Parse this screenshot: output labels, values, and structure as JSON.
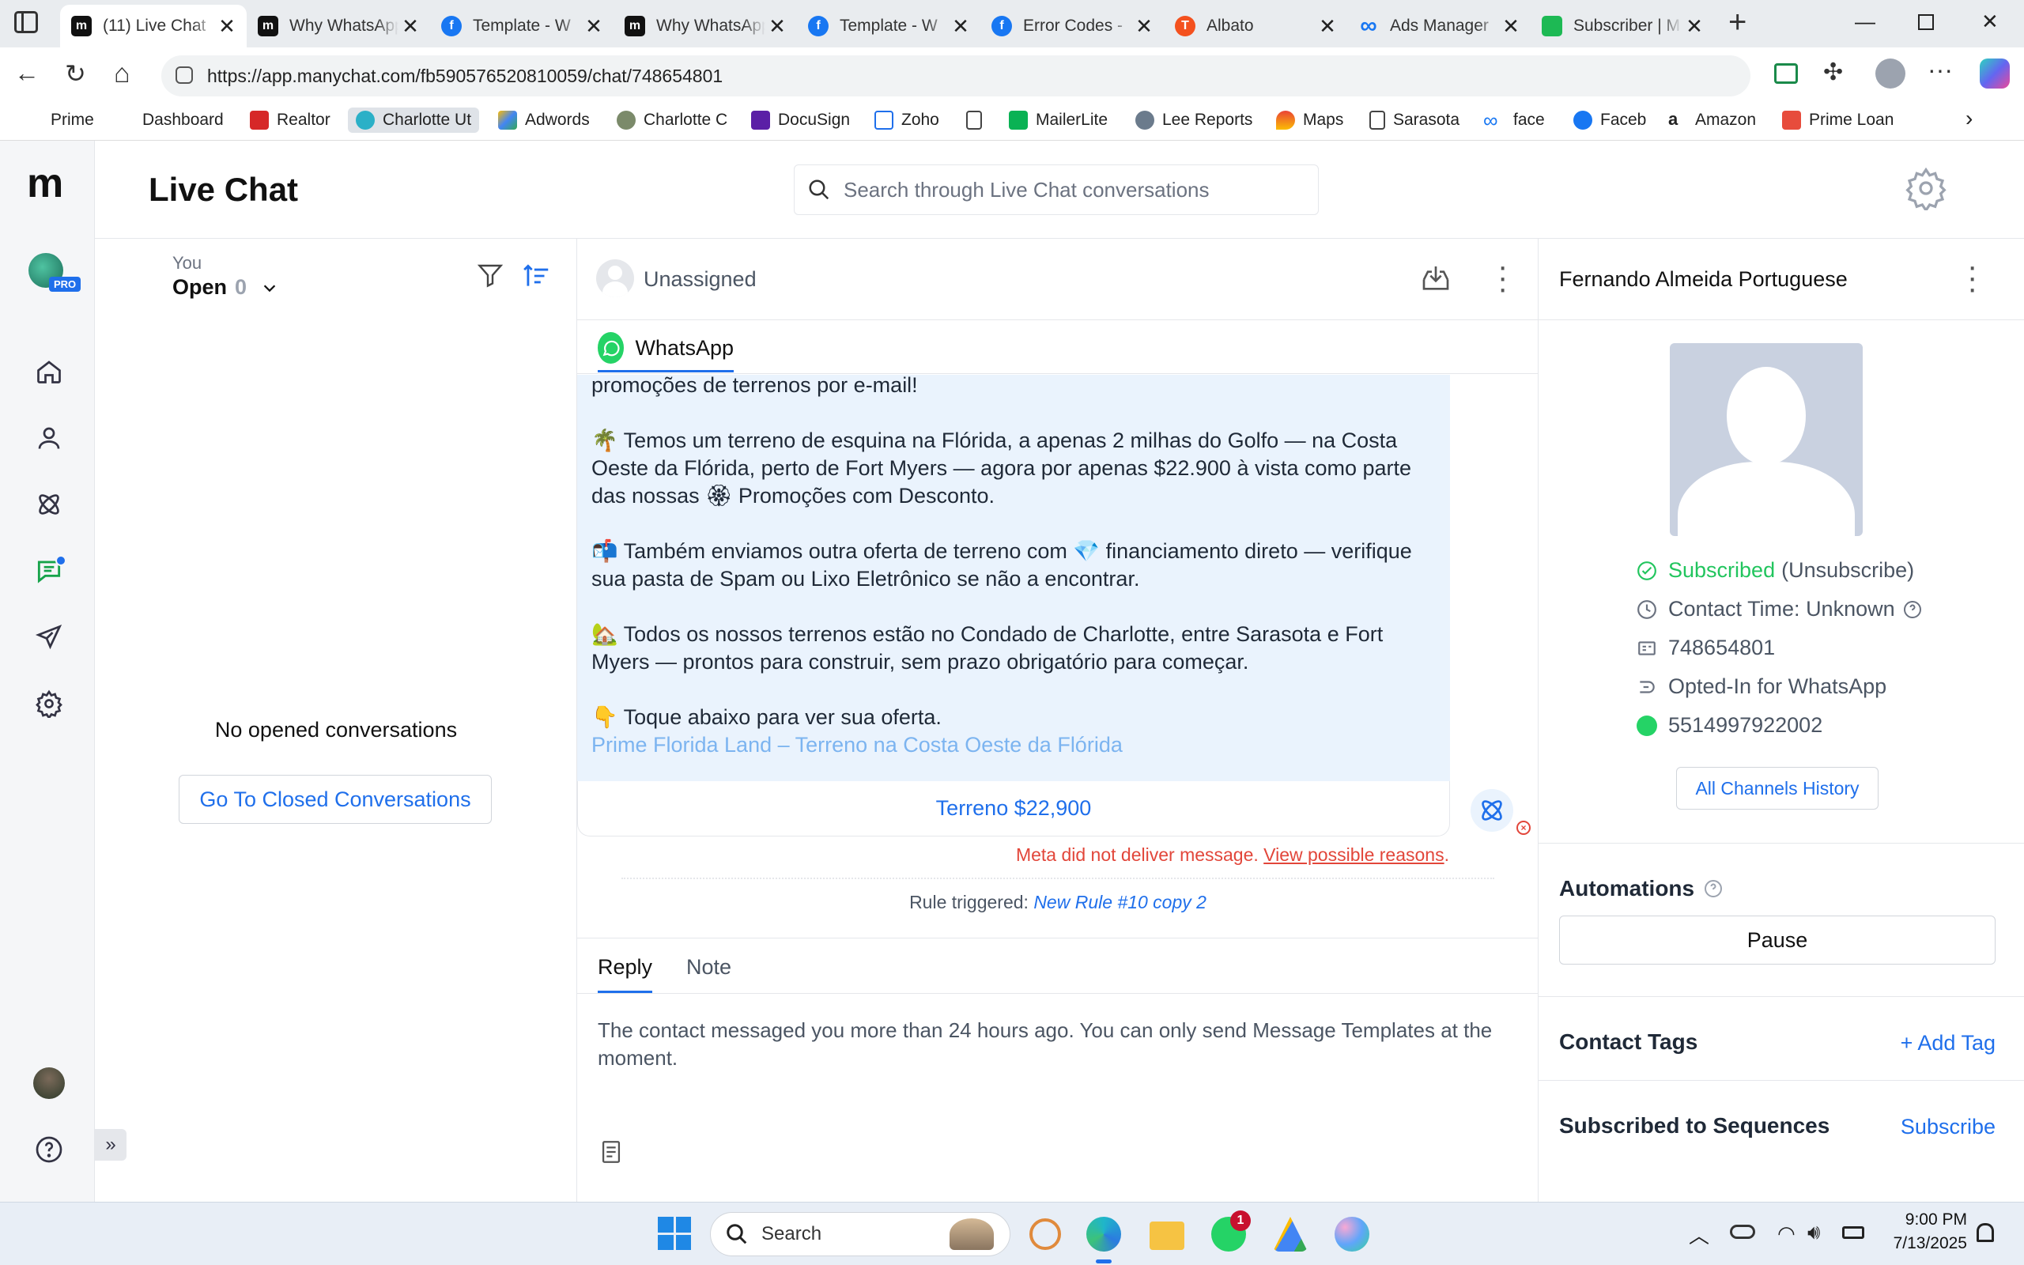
{
  "browser": {
    "tabs": [
      {
        "title": "(11) Live Chat",
        "icon": "manychat-icon",
        "active": true
      },
      {
        "title": "Why WhatsApp",
        "icon": "manychat-icon"
      },
      {
        "title": "Template - W",
        "icon": "facebook-icon"
      },
      {
        "title": "Why WhatsApp",
        "icon": "manychat-icon"
      },
      {
        "title": "Template - W",
        "icon": "facebook-icon"
      },
      {
        "title": "Error Codes -",
        "icon": "facebook-icon"
      },
      {
        "title": "Albato",
        "icon": "albato-icon"
      },
      {
        "title": "Ads Manager",
        "icon": "meta-icon"
      },
      {
        "title": "Subscriber | M",
        "icon": "chat-icon"
      }
    ],
    "url": "https://app.manychat.com/fb590576520810059/chat/748654801",
    "bookmarks": [
      "Prime",
      "Dashboard",
      "Realtor",
      "Charlotte Ut",
      "Adwords",
      "Charlotte C",
      "DocuSign",
      "Zoho",
      "",
      "MailerLite",
      "Lee Reports",
      "Maps",
      "Sarasota",
      "face",
      "Faceb",
      "Amazon",
      "Prime Loan"
    ]
  },
  "app": {
    "page_title": "Live Chat",
    "search_placeholder": "Search through Live Chat conversations",
    "avatar_badge": "PRO"
  },
  "conversations": {
    "owner_label": "You",
    "status_label": "Open",
    "count": "0",
    "empty_text": "No opened conversations",
    "closed_button": "Go To Closed Conversations"
  },
  "chat": {
    "assignee": "Unassigned",
    "channel": "WhatsApp",
    "message_lines": {
      "p1": "promoções de terrenos por e-mail!",
      "p2_emoji": "🌴",
      "p2": "Temos um terreno de esquina na Flórida, a apenas 2 milhas do Golfo — na Costa Oeste da Flórida, perto de Fort Myers — agora por apenas $22.900 à vista como parte das nossas",
      "p2_emoji2": "🏵",
      "p2_end": "Promoções com Desconto.",
      "p3_emoji": "📬",
      "p3a": "Também enviamos outra oferta de terreno com",
      "p3_emoji2": "💎",
      "p3b": "financiamento direto — verifique sua pasta de Spam ou Lixo Eletrônico se não a encontrar.",
      "p4_emoji": "🏡",
      "p4": "Todos os nossos terrenos estão no Condado de Charlotte, entre Sarasota e Fort Myers — prontos para construir, sem prazo obrigatório para começar.",
      "p5_emoji": "👇",
      "p5": "Toque abaixo para ver sua oferta.",
      "link": "Prime Florida Land – Terreno na Costa Oeste da Flórida"
    },
    "button_label": "Terreno $22,900",
    "error_text": "Meta did not deliver message.",
    "error_link": "View possible reasons",
    "rule_label": "Rule triggered:",
    "rule_name": "New Rule #10 copy 2",
    "reply_tabs": [
      "Reply",
      "Note"
    ],
    "composer_notice": "The contact messaged you more than 24 hours ago. You can only send Message Templates at the moment."
  },
  "profile": {
    "name": "Fernando Almeida Portuguese",
    "subscribed": "Subscribed",
    "unsubscribe": "(Unsubscribe)",
    "contact_time": "Contact Time: Unknown",
    "user_id": "748654801",
    "opted_in": "Opted-In for WhatsApp",
    "phone": "5514997922002",
    "history_button": "All Channels History",
    "automations_title": "Automations",
    "pause_button": "Pause",
    "tags_title": "Contact Tags",
    "add_tag": "+ Add Tag",
    "sequences_title": "Subscribed to Sequences",
    "subscribe_link": "Subscribe"
  },
  "taskbar": {
    "search_label": "Search",
    "time": "9:00 PM",
    "date": "7/13/2025",
    "whatsapp_badge": "1"
  },
  "colors": {
    "brand_blue": "#1f6feb",
    "success_green": "#22c55e",
    "error_red": "#e2463a",
    "message_bg": "#eaf3fd",
    "link_blue": "#7cb4f0"
  }
}
